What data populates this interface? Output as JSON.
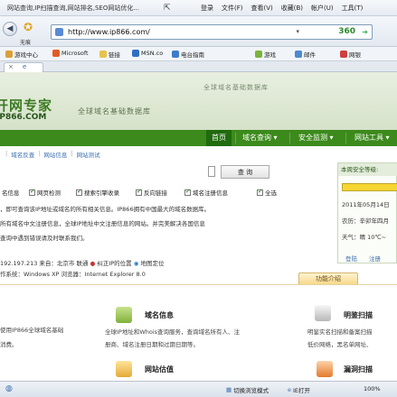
{
  "browser": {
    "title": "网站查询,IP扫描查询,网站排名,SEO网站优化...",
    "menus": [
      "登录",
      "文件(F)",
      "查看(V)",
      "收藏(B)",
      "帐户(U)",
      "工具(T)"
    ],
    "fav_label": "无痕",
    "url": "http://www.ip866.com/",
    "logo360": "360",
    "bookmarks": [
      "游戏中心",
      "Microsoft",
      "链接",
      "MSN.co",
      "电台指南",
      "游戏",
      "邮件",
      "网银"
    ],
    "tab_close": "×",
    "tab_icon": "e"
  },
  "site": {
    "logo_cn": "开网专家",
    "logo_en": "IP866.COM",
    "slogan": "全球域名基础数据库",
    "slogan2": "全球域名基础数据库",
    "nav": [
      "首页",
      "域名查询 ▾",
      "安全监测 ▾",
      "网站工具 ▾"
    ],
    "subnav": [
      "域名反查",
      "网站信息",
      "网站测试"
    ],
    "search_label": "查 询",
    "checkboxes": [
      "网页检测",
      "搜索引擎收录",
      "反向链接",
      "域名注册信息",
      "全选"
    ],
    "checkbox_lead": "名信息",
    "para_lines": [
      "，即可查询该IP地址或域名的所有相关信息。IP866拥有中国最大的域名数据库。",
      "所有域名中文注册信息，全球IP地址中文注册信息的网站。并完美解决各国信息",
      "查询中遇到错误请及时联系我们。"
    ],
    "ip_line": "192.197.213 来自：北京市 联通",
    "ip_error": "纠正IP的位置",
    "ip_map": "地图定位",
    "os_line": "作系统：Windows XP  浏览器：Internet Explorer 8.0"
  },
  "calendar": {
    "head": "本周安全等级:",
    "date": "2011年05月14日",
    "lunar": "农历：辛卯年四月",
    "weather": "天气：晴 10℃~",
    "links": [
      "登陆",
      "注册"
    ]
  },
  "intro": {
    "tab_label": "功能介绍",
    "features": [
      {
        "title": "域名信息",
        "lines": [
          "全球IP地址和Whois查询服务，查询域名所有人、注",
          "册商、域名注册日期和过期日期等。"
        ]
      },
      {
        "title": "网站估值",
        "lines": [
          ""
        ]
      },
      {
        "title": "明鉴扫描",
        "lines": [
          "明鉴实名扫描和备案扫描",
          "低价网络，黑名单网址、"
        ]
      },
      {
        "title": "漏洞扫描",
        "lines": [
          ""
        ]
      }
    ],
    "left_text": [
      "使用IP866全球域名基础",
      "消费。"
    ]
  },
  "status": {
    "items": [
      "切换浏览模式",
      "IE打开",
      "100%"
    ]
  },
  "colors": {
    "brand_green": "#3c8a1c",
    "accent_yellow": "#f6d533"
  }
}
